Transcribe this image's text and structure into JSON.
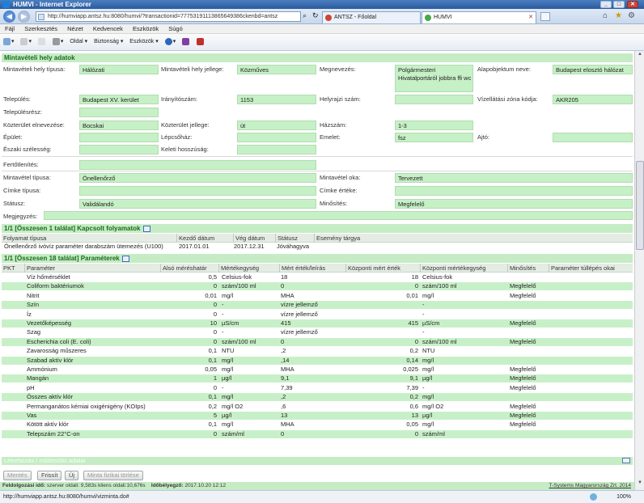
{
  "window": {
    "title": "HUMVI - Internet Explorer",
    "url": "http://humviapp.antsz.hu:8080/humvi/?transactionid=77753191113865649386ckenbd=antsz",
    "tabs": [
      "ANTSZ - Főoldal",
      "HUMVI"
    ]
  },
  "menu": [
    "Fájl",
    "Szerkesztés",
    "Nézet",
    "Kedvencek",
    "Eszközök",
    "Súgó"
  ],
  "toolbar": [
    "Oldal",
    "Biztonság",
    "Eszközök"
  ],
  "mintaveteli": {
    "header": "Mintavételi hely adatok",
    "tipus_label": "Mintavételi hely típusa:",
    "tipus": "Hálózati",
    "jelleg_label": "Mintavételi hely jellege:",
    "jelleg": "Közműves",
    "megnevezes_label": "Megnevezés:",
    "megnevezes": "Polgármesteri Hivatalportáról jobbra ffi wc",
    "alapobjektum_label": "Alapobjektum neve:",
    "alapobjektum": "Budapest elosztó hálózat",
    "telepules_label": "Település:",
    "telepules": "Budapest XV. kerület",
    "iranyitoszam_label": "Irányítószám:",
    "iranyitoszam": "1153",
    "helyrajzi_label": "Helyrajzi szám:",
    "helyrajzi": "",
    "vizellatasi_label": "Vízellátási zóna kódja:",
    "vizellatasi": "AKR205",
    "telepulesresz_label": "Településrész:",
    "telepulesresz": "",
    "kozterulet_label": "Közterület elnevezése:",
    "kozterulet": "Bocskai",
    "kozterulet_jelleg_label": "Közterület jellege:",
    "kozterulet_jelleg": "út",
    "hazszam_label": "Házszám:",
    "hazszam": "1-3",
    "epulet_label": "Épület:",
    "epulet": "",
    "lepcsohaz_label": "Lépcsőház:",
    "lepcsohaz": "",
    "emelet_label": "Emelet:",
    "emelet": "fsz",
    "ajto_label": "Ajtó:",
    "ajto": "",
    "eszaki_label": "Északi szélesség:",
    "eszaki": "",
    "keleti_label": "Keleti hosszúság:",
    "keleti": "",
    "fertotlenites_label": "Fertőtlenítés:",
    "fertotlenites": "",
    "mintavetel_tipusa_label": "Mintavétel típusa:",
    "mintavetel_tipusa": "Önellenőrző",
    "mintavetel_oka_label": "Mintavétel oka:",
    "mintavetel_oka": "Tervezett",
    "cimke_tipusa_label": "Címke típusa:",
    "cimke_tipusa": "",
    "cimke_erteke_label": "Címke értéke:",
    "cimke_erteke": "",
    "statusz_label": "Státusz:",
    "statusz": "Validálandó",
    "minosites_label": "Minősítés:",
    "minosites": "Megfelelő",
    "megjegyzes_label": "Megjegyzés:",
    "megjegyzes": ""
  },
  "folyamatok": {
    "header": "1/1 [Összesen 1 találat]  Kapcsolt folyamatok",
    "columns": [
      "Folyamat típusa",
      "Kezdő dátum",
      "Vég dátum",
      "Státusz",
      "Esemény tárgya"
    ],
    "row": [
      "Önellenőrző ivóvíz paraméter darabszám ütemezés (U100)",
      "2017.01.01",
      "2017.12.31",
      "Jóváhagyva",
      ""
    ]
  },
  "parameterek": {
    "header": "1/1 [Összesen 18 találat]  Paraméterek",
    "columns": [
      "PKT",
      "Paraméter",
      "Alsó méréshatár",
      "Mértékegység",
      "Mért érték/leírás",
      "Központi mért érték",
      "Központi mértékegység",
      "Minősítés",
      "Paraméter túllépés okai"
    ],
    "rows": [
      [
        "",
        "Víz hőmérséklet",
        "0,5",
        "Celsius-fok",
        "18",
        "18",
        "Celsius-fok",
        ""
      ],
      [
        "",
        "Coliform baktériumok",
        "0",
        "szám/100 ml",
        "0",
        "0",
        "szám/100 ml",
        "Megfelelő"
      ],
      [
        "",
        "Nitrit",
        "0,01",
        "mg/l",
        "MHA",
        "0,01",
        "mg/l",
        "Megfelelő"
      ],
      [
        "",
        "Szín",
        "0",
        "-",
        "vízre jellemző",
        "",
        "-",
        ""
      ],
      [
        "",
        "Íz",
        "0",
        "-",
        "vízre jellemző",
        "",
        "-",
        ""
      ],
      [
        "",
        "Vezetőképesség",
        "10",
        "µS/cm",
        "415",
        "415",
        "µS/cm",
        "Megfelelő"
      ],
      [
        "",
        "Szag",
        "0",
        "-",
        "vízre jellemző",
        "",
        "-",
        ""
      ],
      [
        "",
        "Escherichia coli (E. coli)",
        "0",
        "szám/100 ml",
        "0",
        "0",
        "szám/100 ml",
        "Megfelelő"
      ],
      [
        "",
        "Zavarosság műszeres",
        "0,1",
        "NTU",
        ",2",
        "0,2",
        "NTU",
        ""
      ],
      [
        "",
        "Szabad aktív klór",
        "0,1",
        "mg/l",
        ",14",
        "0,14",
        "mg/l",
        ""
      ],
      [
        "",
        "Ammónium",
        "0,05",
        "mg/l",
        "MHA",
        "0,025",
        "mg/l",
        "Megfelelő"
      ],
      [
        "",
        "Mangán",
        "1",
        "µg/l",
        "9,1",
        "9,1",
        "µg/l",
        "Megfelelő"
      ],
      [
        "",
        "pH",
        "0",
        "-",
        "7,39",
        "7,39",
        "-",
        "Megfelelő"
      ],
      [
        "",
        "Összes aktív klór",
        "0,1",
        "mg/l",
        ",2",
        "0,2",
        "mg/l",
        ""
      ],
      [
        "",
        "Permanganátos kémiai oxigénigény (KOIps)",
        "0,2",
        "mg/l O2",
        ",6",
        "0,6",
        "mg/l O2",
        "Megfelelő"
      ],
      [
        "",
        "Vas",
        "5",
        "µg/l",
        "13",
        "13",
        "µg/l",
        "Megfelelő"
      ],
      [
        "",
        "Kötött aktív klór",
        "0,1",
        "mg/l",
        "MHA",
        "0,05",
        "mg/l",
        "Megfelelő"
      ],
      [
        "",
        "Telepszám 22°C-on",
        "0",
        "szám/ml",
        "0",
        "0",
        "szám/ml",
        ""
      ]
    ]
  },
  "audit": {
    "label": "Létrehozás / módosítás adatai"
  },
  "buttons": {
    "mentes": "Mentés",
    "frissit": "Frissít",
    "uj": "Új",
    "torles": "Minta fizikai törlése"
  },
  "footer": {
    "feldolgozasi_label": "Feldolgozási idő:",
    "feldolgozasi": "szerver oldali: 9,583s kliens oldali:10,676s",
    "idobelyegzo_label": "Időbélyegző:",
    "idobelyegzo": "2017.10.20 12:12",
    "corp": "T-Systems Magyarország Zrt. 2014"
  },
  "status": {
    "url": "http://humviapp.antsz.hu:8080/humvi/vizminta.do#",
    "zoom": "100%"
  }
}
